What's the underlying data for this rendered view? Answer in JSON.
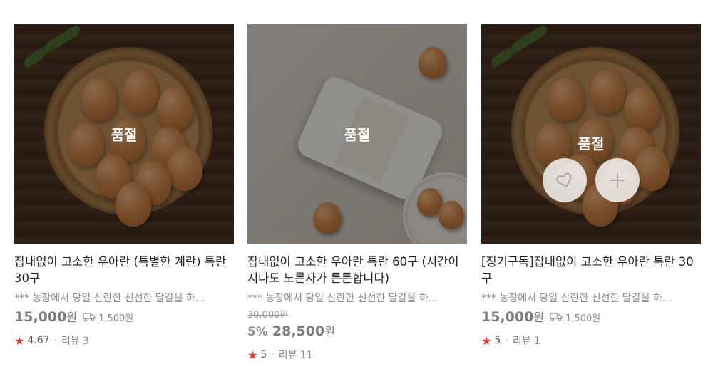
{
  "products": [
    {
      "soldout_label": "품절",
      "title": "잡내없이 고소한 우아란 (특별한 계란) 특란 30구",
      "desc": "*** 농장에서 당일 산란한 신선한 달걀을 하...",
      "price": "15,000",
      "currency": "원",
      "shipping": "1,500원",
      "rating": "4.67",
      "review": "리뷰 3"
    },
    {
      "soldout_label": "품절",
      "title": "잡내없이 고소한 우아란 특란 60구 (시간이 지나도 노른자가 튼튼합니다)",
      "desc": "*** 농장에서 당일 산란한 신선한 달걀을 하...",
      "original_price": "30,000원",
      "discount": "5%",
      "price": "28,500",
      "currency": "원",
      "rating": "5",
      "review": "리뷰 11"
    },
    {
      "soldout_label": "품절",
      "title": "[정기구독]잡내없이 고소한 우아란 특란 30구",
      "desc": "*** 농장에서 당일 산란한 신선한 달걀을 하...",
      "price": "15,000",
      "currency": "원",
      "shipping": "1,500원",
      "rating": "5",
      "review": "리뷰 1"
    }
  ],
  "icons": {
    "wishlist": "heart-icon",
    "add": "plus-icon",
    "shipping": "delivery-truck-icon",
    "rating": "star-icon"
  },
  "colors": {
    "star": "#e5342d",
    "overlay": "rgba(0,0,0,0.40)"
  }
}
